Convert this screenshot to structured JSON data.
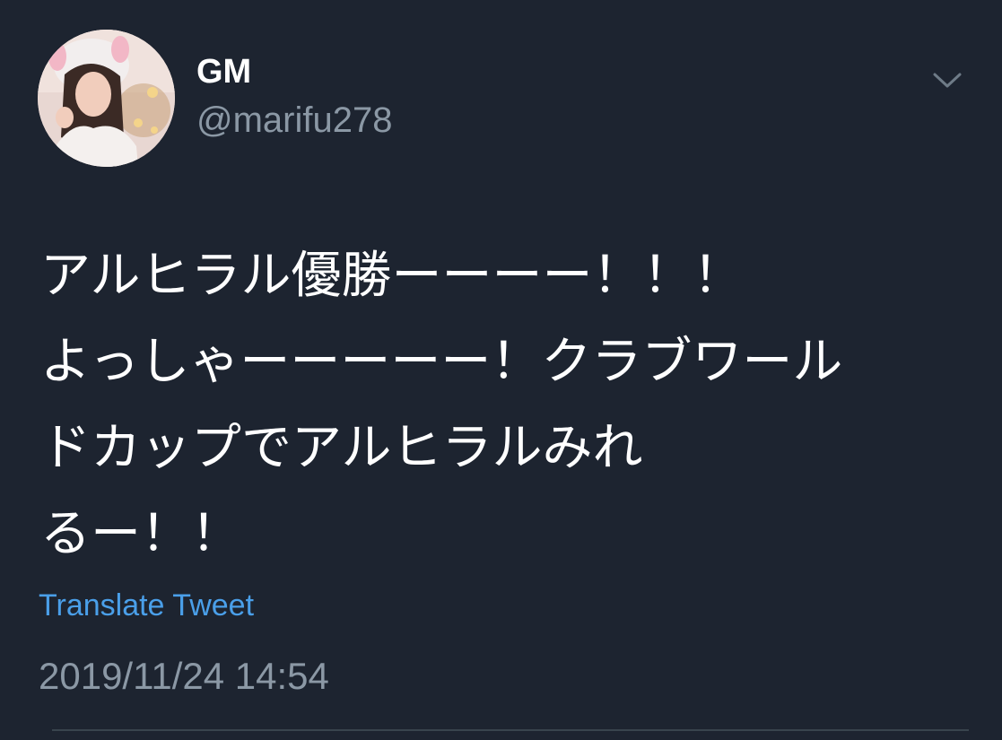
{
  "user": {
    "display_name": "GM",
    "handle": "@marifu278",
    "avatar_icon": "profile-photo"
  },
  "menu": {
    "icon": "chevron-down-icon"
  },
  "tweet": {
    "lines": [
      "アルヒラル優勝ーーーー！！！",
      "よっしゃーーーーー！クラブワール",
      "ドカップでアルヒラルみれ",
      "るー！！"
    ]
  },
  "translate_label": "Translate Tweet",
  "timestamp": "2019/11/24 14:54",
  "colors": {
    "background": "#1d2430",
    "text": "#ffffff",
    "secondary": "#8b98a5",
    "link": "#4a9fe9",
    "divider": "#38444d"
  }
}
